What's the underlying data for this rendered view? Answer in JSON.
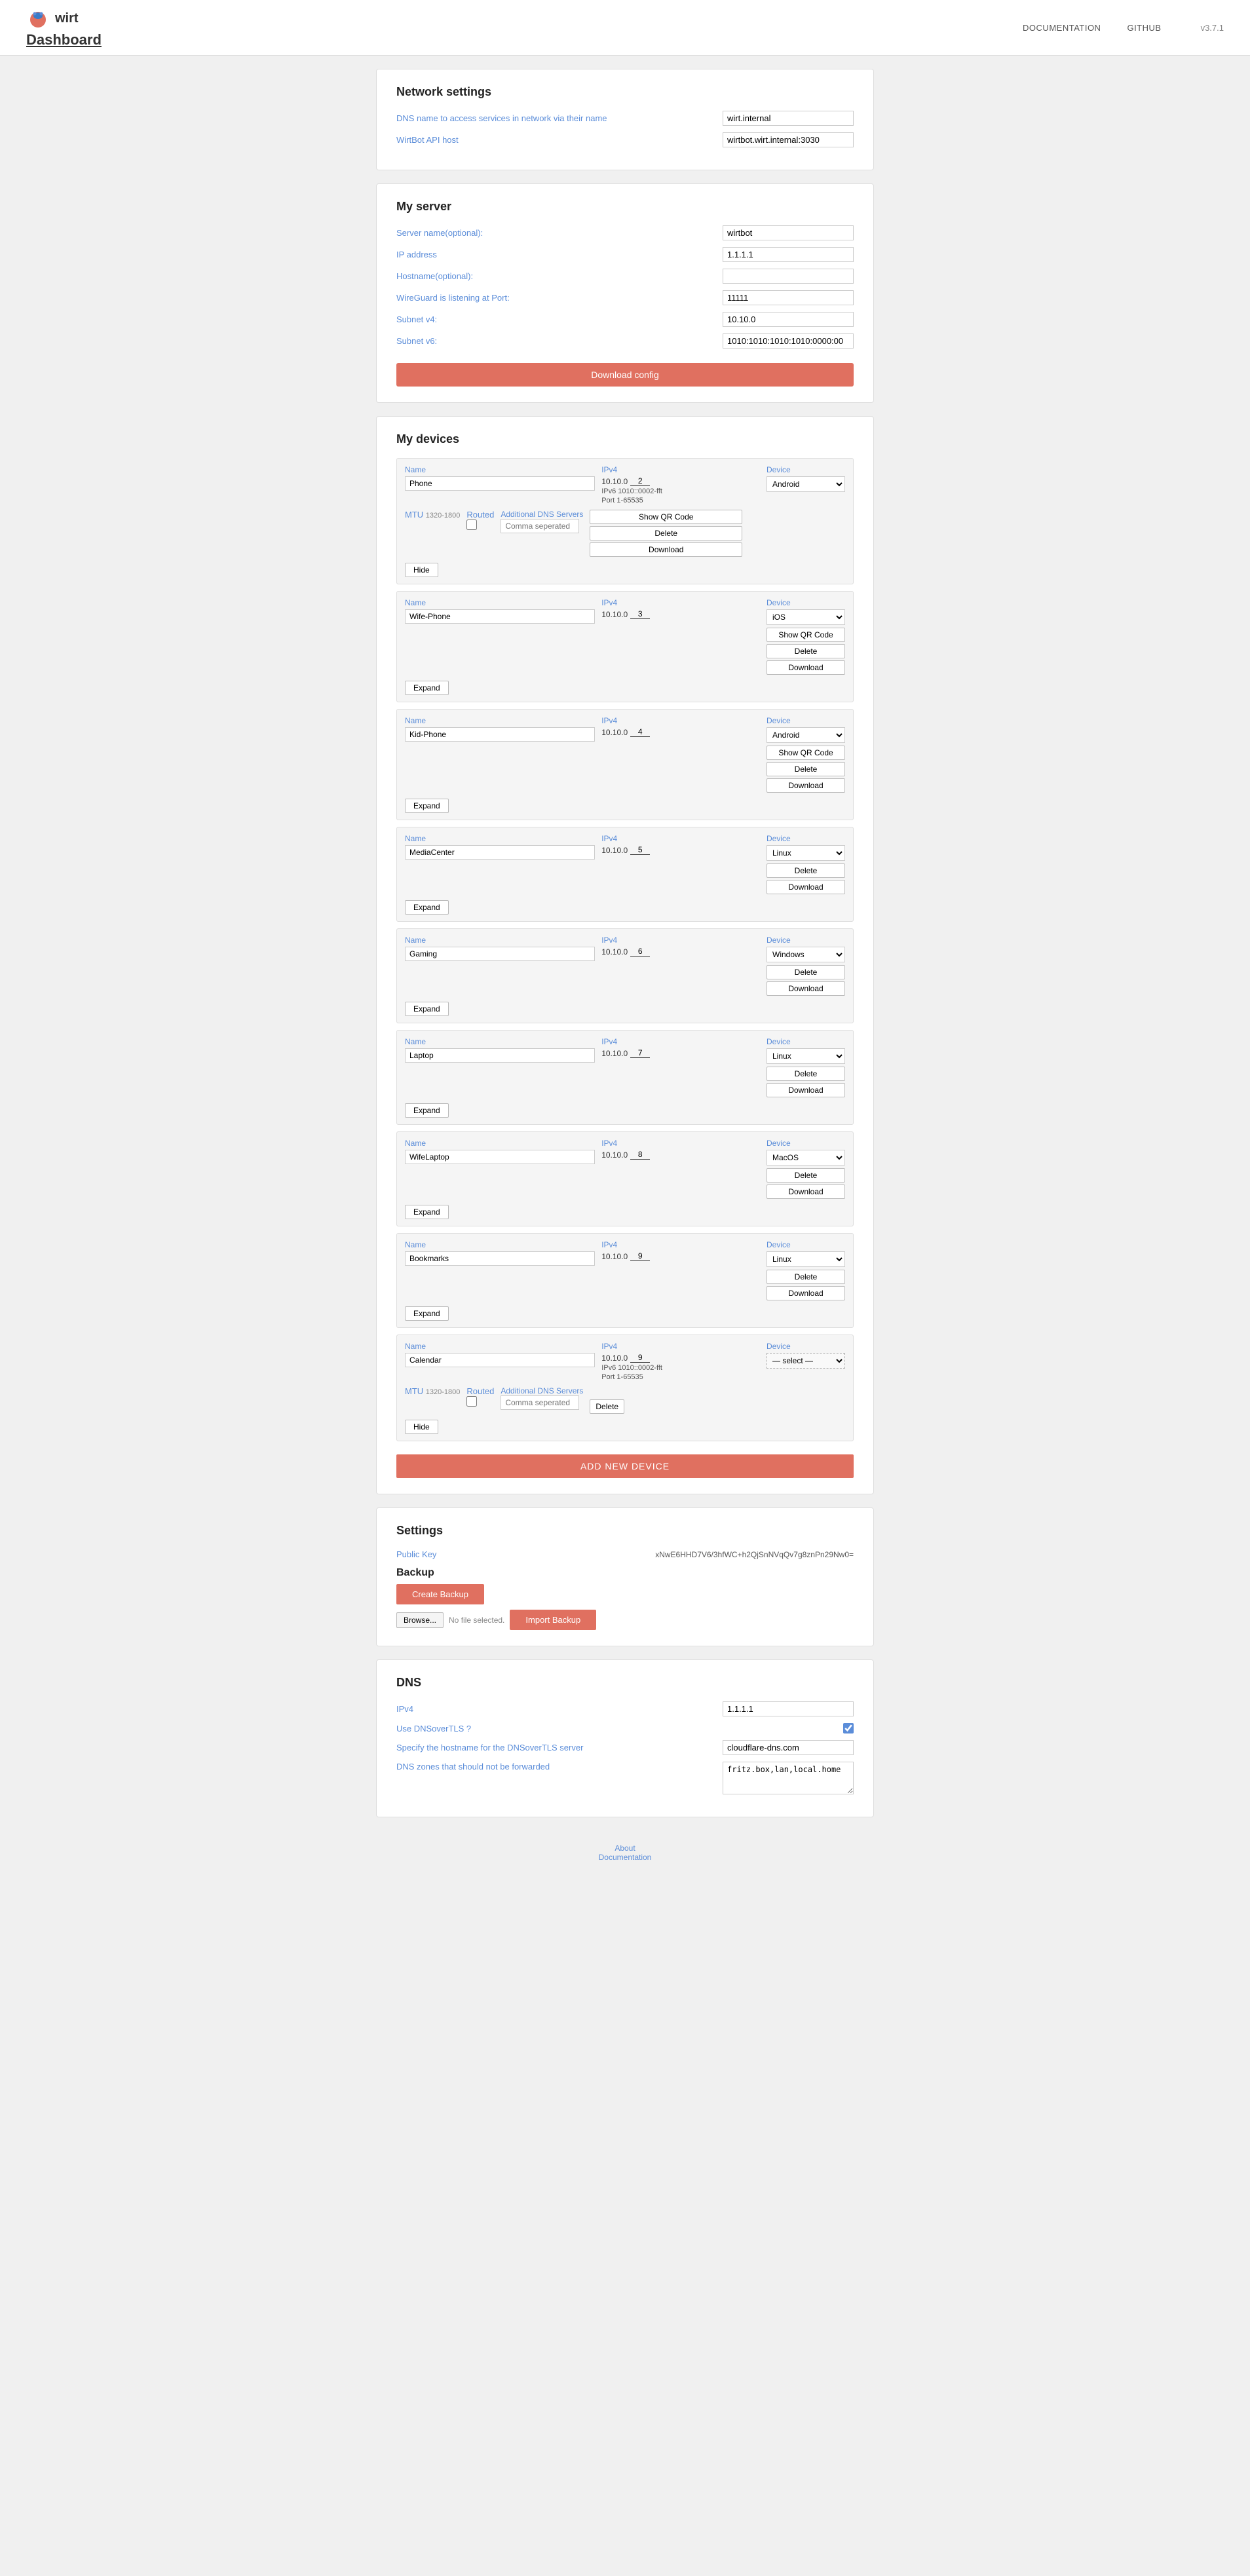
{
  "header": {
    "logo_text": "wirt",
    "dashboard_label": "Dashboard",
    "nav": {
      "docs": "DOCUMENTATION",
      "github": "GITHUB"
    },
    "version": "v3.7.1"
  },
  "network_settings": {
    "title": "Network settings",
    "dns_label": "DNS name to access services in network via their name",
    "dns_value": "wirt.internal",
    "api_label": "WirtBot API host",
    "api_value": "wirtbot.wirt.internal:3030"
  },
  "my_server": {
    "title": "My server",
    "fields": [
      {
        "label": "Server name(optional):",
        "value": "wirtbot"
      },
      {
        "label": "IP address",
        "value": "1.1.1.1"
      },
      {
        "label": "Hostname(optional):",
        "value": ""
      },
      {
        "label": "WireGuard is listening at Port:",
        "value": "11111"
      },
      {
        "label": "Subnet v4:",
        "value": "10.10.0"
      },
      {
        "label": "Subnet v6:",
        "value": "1010:1010:1010:1010:0000:00"
      }
    ],
    "download_config": "Download config"
  },
  "my_devices": {
    "title": "My devices",
    "labels": {
      "name": "Name",
      "ipv4": "IPv4",
      "ipv6": "IPv6",
      "port": "Port",
      "device": "Device",
      "mtu": "MTU",
      "dns": "Additional DNS Servers",
      "routed": "Routed"
    },
    "devices": [
      {
        "name": "Phone",
        "ipv4_prefix": "10.10.0",
        "ipv4_suffix": "2",
        "ipv6": "1010::0002-fft",
        "port": "1-65535",
        "device_type": "Android",
        "mtu_range": "1320-1800",
        "dns_placeholder": "Comma seperated",
        "routed": false,
        "expanded": true,
        "show_qr": true,
        "buttons": [
          "Show QR Code",
          "Delete",
          "Download"
        ]
      },
      {
        "name": "Wife-Phone",
        "ipv4_prefix": "10.10.0",
        "ipv4_suffix": "3",
        "device_type": "iOS",
        "expanded": false,
        "show_qr": true,
        "buttons": [
          "Show QR Code",
          "Delete",
          "Download"
        ]
      },
      {
        "name": "Kid-Phone",
        "ipv4_prefix": "10.10.0",
        "ipv4_suffix": "4",
        "device_type": "Android",
        "expanded": false,
        "show_qr": true,
        "buttons": [
          "Show QR Code",
          "Delete",
          "Download"
        ]
      },
      {
        "name": "MediaCenter",
        "ipv4_prefix": "10.10.0",
        "ipv4_suffix": "5",
        "device_type": "Linux",
        "expanded": false,
        "show_qr": false,
        "buttons": [
          "Delete",
          "Download"
        ]
      },
      {
        "name": "Gaming",
        "ipv4_prefix": "10.10.0",
        "ipv4_suffix": "6",
        "device_type": "Windows",
        "expanded": false,
        "show_qr": false,
        "buttons": [
          "Delete",
          "Download"
        ]
      },
      {
        "name": "Laptop",
        "ipv4_prefix": "10.10.0",
        "ipv4_suffix": "7",
        "device_type": "Linux",
        "expanded": false,
        "show_qr": false,
        "buttons": [
          "Delete",
          "Download"
        ]
      },
      {
        "name": "WifeLaptop",
        "ipv4_prefix": "10.10.0",
        "ipv4_suffix": "8",
        "device_type": "MacOS",
        "expanded": false,
        "show_qr": false,
        "buttons": [
          "Delete",
          "Download"
        ]
      },
      {
        "name": "Bookmarks",
        "ipv4_prefix": "10.10.0",
        "ipv4_suffix": "9",
        "device_type": "Linux",
        "expanded": false,
        "show_qr": false,
        "buttons": [
          "Delete",
          "Download"
        ]
      },
      {
        "name": "Calendar",
        "ipv4_prefix": "10.10.0",
        "ipv4_suffix": "9",
        "ipv6": "1010::0002-fft",
        "port": "1-65535",
        "device_type": "",
        "mtu_range": "1320-1800",
        "dns_placeholder": "Comma seperated",
        "routed": false,
        "expanded": true,
        "show_qr": false,
        "ipv6_dashed": true,
        "buttons": [
          "Delete"
        ]
      }
    ],
    "add_device": "ADD NEW DEVICE",
    "expand_label": "Expand",
    "hide_label": "Hide",
    "device_options": [
      "Android",
      "iOS",
      "Linux",
      "Windows",
      "MacOS"
    ]
  },
  "settings": {
    "title": "Settings",
    "public_key_label": "Public Key",
    "public_key_value": "xNwE6HHD7V6/3hfWC+h2QjSnNVqQv7g8znPn29Nw0=",
    "backup_title": "Backup",
    "create_backup": "Create Backup",
    "browse_label": "Browse...",
    "no_file": "No file selected.",
    "import_backup": "Import Backup"
  },
  "dns": {
    "title": "DNS",
    "ipv4_label": "IPv4",
    "ipv4_value": "1.1.1.1",
    "dnsovertls_label": "Use DNSoverTLS ?",
    "dnsovertls_checked": true,
    "hostname_label": "Specify the hostname for the DNSoverTLS server",
    "hostname_value": "cloudflare-dns.com",
    "zones_label": "DNS zones that should not be forwarded",
    "zones_value": "fritz.box,lan,local.home"
  },
  "footer": {
    "about": "About",
    "documentation": "Documentation"
  }
}
